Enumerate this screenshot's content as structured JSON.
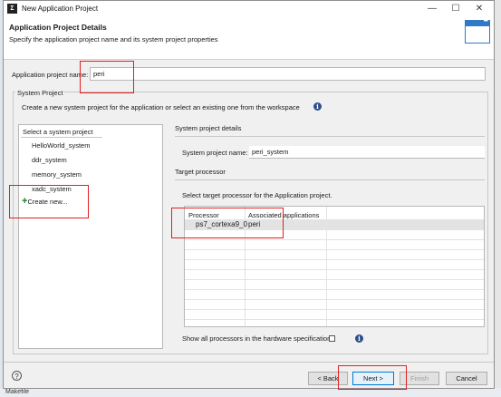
{
  "window": {
    "title": "New Application Project",
    "minimize_glyph": "—",
    "maximize_glyph": "☐",
    "close_glyph": "✕"
  },
  "header": {
    "title": "Application Project Details",
    "subtitle": "Specify the application project name and its system project properties"
  },
  "app_project": {
    "label": "Application project name:",
    "value": "peri"
  },
  "system_project": {
    "group_label": "System Project",
    "description": "Create a new system project for the application or select an existing one from the workspace",
    "list_header": "Select a system project",
    "items": [
      "HelloWorld_system",
      "ddr_system",
      "memory_system",
      "xadc_system"
    ],
    "create_new": "Create new..."
  },
  "details": {
    "section_title": "System project details",
    "name_label": "System project name:",
    "name_value": "peri_system",
    "target_title": "Target processor",
    "target_prompt": "Select target processor for the Application project.",
    "columns": [
      "Processor",
      "Associated applications"
    ],
    "rows": [
      {
        "processor": "ps7_cortexa9_0",
        "apps": "peri"
      }
    ],
    "show_all_label": "Show all processors in the hardware specification"
  },
  "footer": {
    "help_glyph": "?",
    "back": "< Back",
    "next": "Next >",
    "finish": "Finish",
    "cancel": "Cancel"
  },
  "background": {
    "bottom_text": "Makefile"
  },
  "colors": {
    "highlight": "#e02020",
    "accent": "#2f79c7"
  }
}
